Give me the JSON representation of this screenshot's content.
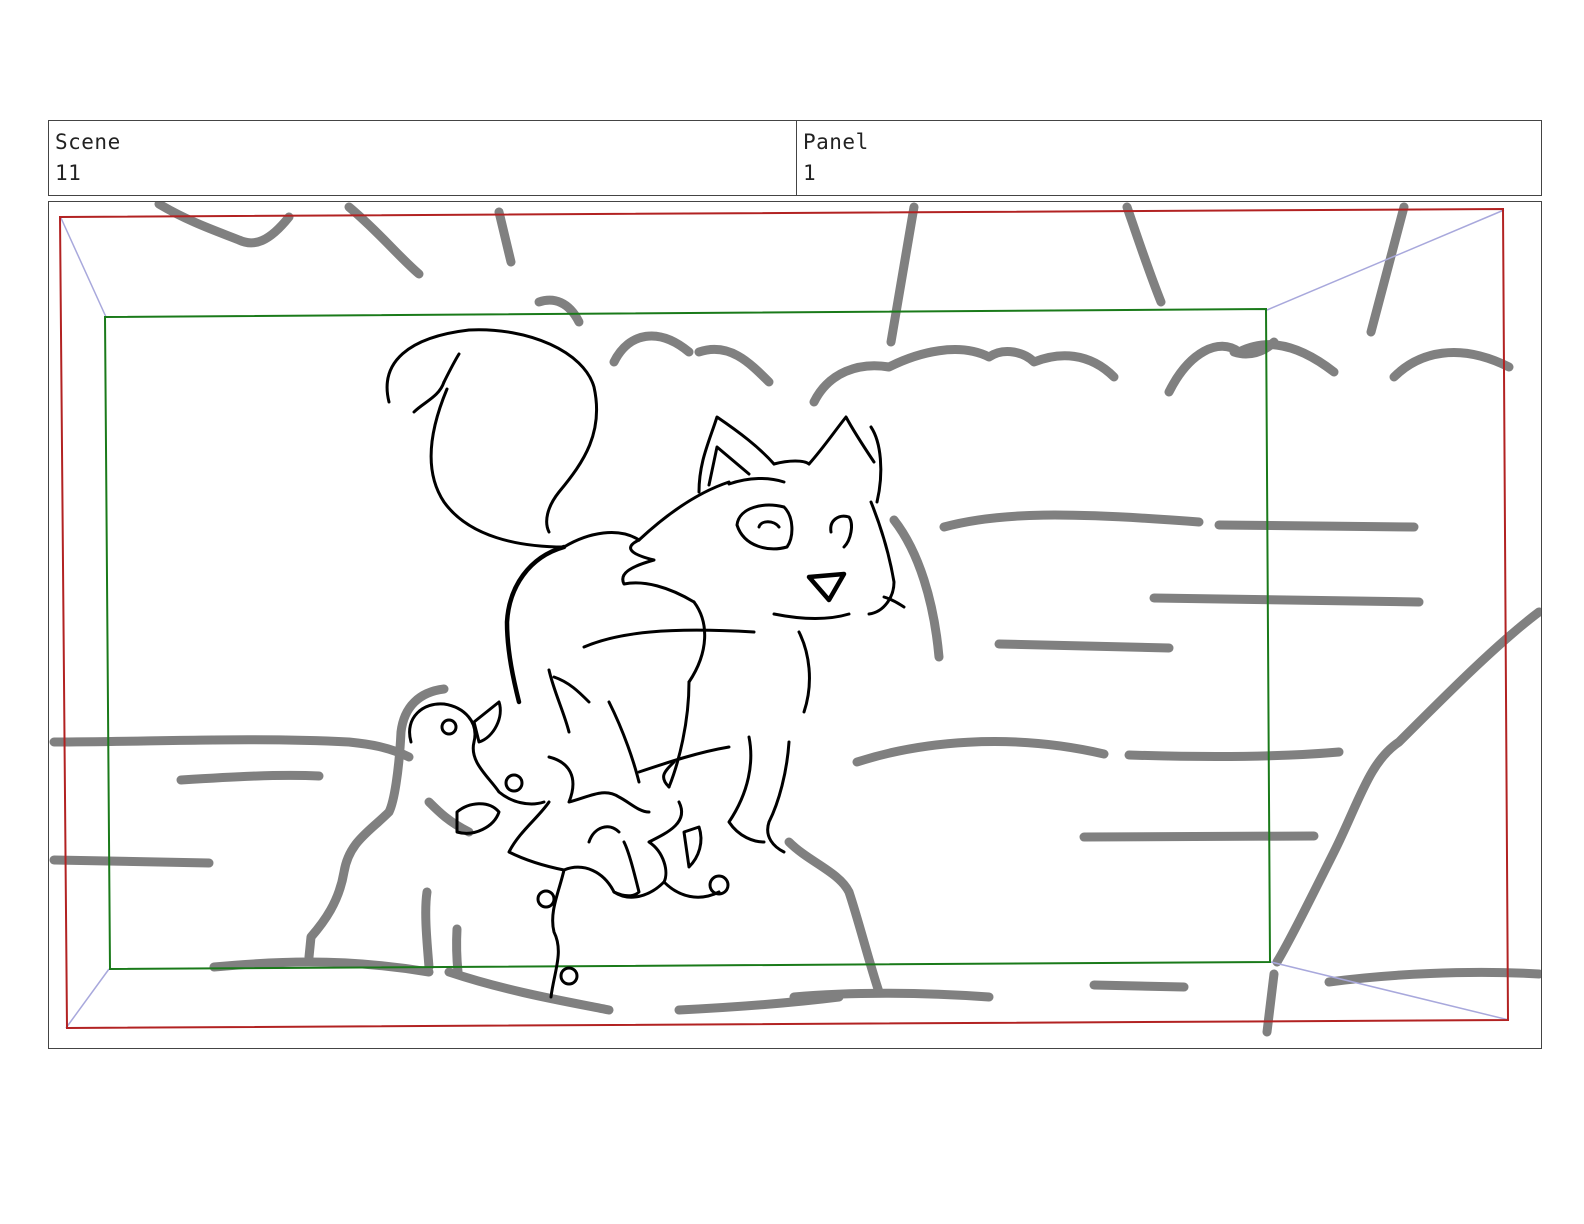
{
  "header": {
    "scene_label": "Scene",
    "scene_value": "11",
    "panel_label": "Panel",
    "panel_value": "1"
  },
  "panel": {
    "illustration": "storyboard-sketch",
    "colors": {
      "camera_frame": "#b22222",
      "safe_frame": "#1a7a1a",
      "perspective_lines": "#a8a8dc",
      "background_lines": "#808080",
      "foreground_ink": "#000000"
    }
  }
}
